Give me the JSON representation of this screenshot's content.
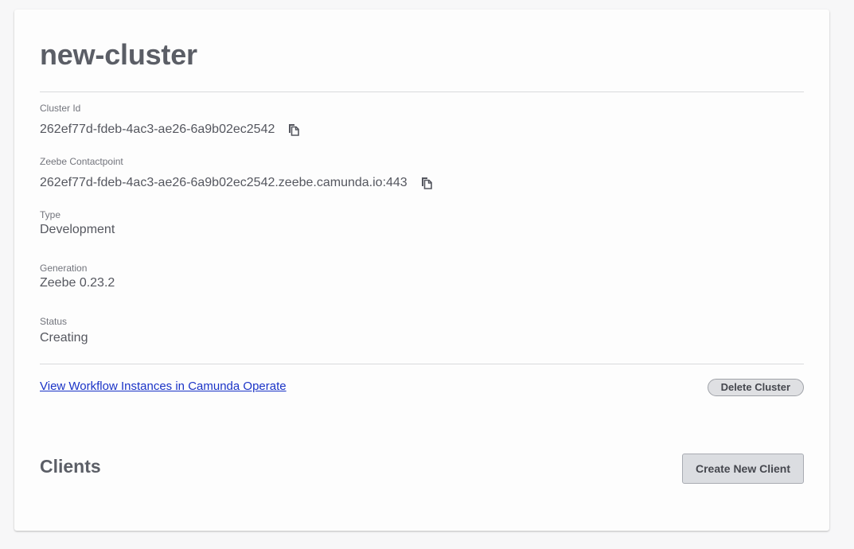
{
  "cluster": {
    "name": "new-cluster"
  },
  "fields": {
    "cluster_id": {
      "label": "Cluster Id",
      "value": "262ef77d-fdeb-4ac3-ae26-6a9b02ec2542"
    },
    "contactpoint": {
      "label": "Zeebe Contactpoint",
      "value": "262ef77d-fdeb-4ac3-ae26-6a9b02ec2542.zeebe.camunda.io:443"
    },
    "type": {
      "label": "Type",
      "value": "Development"
    },
    "generation": {
      "label": "Generation",
      "value": "Zeebe 0.23.2"
    },
    "status": {
      "label": "Status",
      "value": "Creating"
    }
  },
  "actions": {
    "operate_link": "View Workflow Instances in Camunda Operate",
    "delete_label": "Delete Cluster"
  },
  "clients": {
    "title": "Clients",
    "create_label": "Create New Client"
  },
  "icons": {
    "copy": "copy-icon"
  },
  "colors": {
    "link": "#1a33c7",
    "text": "#52545e",
    "button_bg": "#dbdde1"
  }
}
